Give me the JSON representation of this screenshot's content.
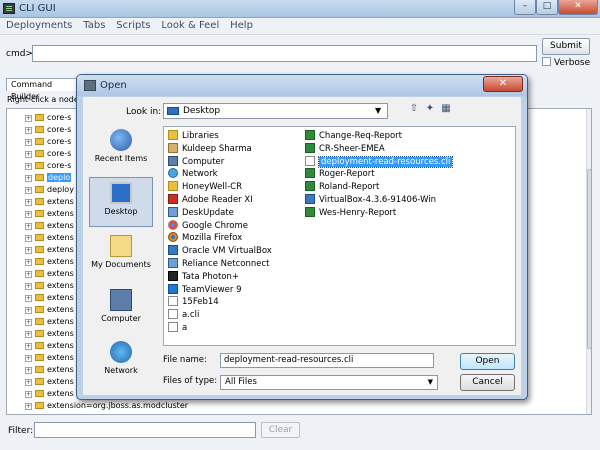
{
  "window": {
    "title": "CLI GUI",
    "controls": {
      "minimize": "–",
      "maximize": "□",
      "close": "✕"
    }
  },
  "menubar": [
    "Deployments",
    "Tabs",
    "Scripts",
    "Look & Feel",
    "Help"
  ],
  "command": {
    "label": "cmd>",
    "value": "",
    "submit_label": "Submit",
    "verbose_label": "Verbose",
    "verbose_checked": false
  },
  "tab_label": "Command Builder",
  "hint": "Right-click a node",
  "tree": {
    "items": [
      {
        "label": "core-s",
        "expander": "+"
      },
      {
        "label": "core-s",
        "expander": "+"
      },
      {
        "label": "core-s",
        "expander": "+"
      },
      {
        "label": "core-s",
        "expander": "+"
      },
      {
        "label": "core-s",
        "expander": "+"
      },
      {
        "label": "deplo",
        "expander": "+",
        "selected": true
      },
      {
        "label": "deploy",
        "expander": "+"
      },
      {
        "label": "extens",
        "expander": "+"
      },
      {
        "label": "extens",
        "expander": "+"
      },
      {
        "label": "extens",
        "expander": "+"
      },
      {
        "label": "extens",
        "expander": "+"
      },
      {
        "label": "extens",
        "expander": "+"
      },
      {
        "label": "extens",
        "expander": "+"
      },
      {
        "label": "extens",
        "expander": "+"
      },
      {
        "label": "extens",
        "expander": "+"
      },
      {
        "label": "extens",
        "expander": "+"
      },
      {
        "label": "extens",
        "expander": "+"
      },
      {
        "label": "extens",
        "expander": "+"
      },
      {
        "label": "extens",
        "expander": "+"
      },
      {
        "label": "extens",
        "expander": "+"
      },
      {
        "label": "extens",
        "expander": "+"
      },
      {
        "label": "extens",
        "expander": "+"
      },
      {
        "label": "extens",
        "expander": "+"
      },
      {
        "label": "extens",
        "expander": "+"
      },
      {
        "label": "extension=org.jboss.as.modcluster",
        "expander": "+"
      }
    ]
  },
  "filter": {
    "label": "Filter:",
    "value": "",
    "clear_label": "Clear"
  },
  "dialog": {
    "title": "Open",
    "close": "✕",
    "look_in_label": "Look in:",
    "look_in_value": "Desktop",
    "toolbar_icons": [
      "up-folder-icon",
      "new-folder-icon",
      "view-menu-icon"
    ],
    "places": [
      {
        "label": "Recent Items",
        "icon": "recent-items-icon"
      },
      {
        "label": "Desktop",
        "icon": "desktop-icon",
        "selected": true
      },
      {
        "label": "My Documents",
        "icon": "documents-icon"
      },
      {
        "label": "Computer",
        "icon": "computer-icon"
      },
      {
        "label": "Network",
        "icon": "network-icon"
      }
    ],
    "files_col1": [
      {
        "name": "Libraries",
        "icon": "folder"
      },
      {
        "name": "Kuldeep Sharma",
        "icon": "user"
      },
      {
        "name": "Computer",
        "icon": "computer"
      },
      {
        "name": "Network",
        "icon": "network"
      },
      {
        "name": "HoneyWell-CR",
        "icon": "folder"
      },
      {
        "name": "Adobe Reader XI",
        "icon": "pdf"
      },
      {
        "name": "DeskUpdate",
        "icon": "app"
      },
      {
        "name": "Google Chrome",
        "icon": "chrome"
      },
      {
        "name": "Mozilla Firefox",
        "icon": "firefox"
      },
      {
        "name": "Oracle VM VirtualBox",
        "icon": "vbox"
      },
      {
        "name": "Reliance Netconnect",
        "icon": "app"
      },
      {
        "name": "Tata Photon+",
        "icon": "tata"
      },
      {
        "name": "TeamViewer 9",
        "icon": "tv"
      },
      {
        "name": "15Feb14",
        "icon": "doc"
      },
      {
        "name": "a.cli",
        "icon": "doc"
      },
      {
        "name": "a",
        "icon": "doc"
      }
    ],
    "files_col2": [
      {
        "name": "Change-Req-Report",
        "icon": "xls"
      },
      {
        "name": "CR-Sheer-EMEA",
        "icon": "xls"
      },
      {
        "name": "deployment-read-resources.cli",
        "icon": "doc",
        "selected": true
      },
      {
        "name": "Roger-Report",
        "icon": "xls"
      },
      {
        "name": "Roland-Report",
        "icon": "xls"
      },
      {
        "name": "VirtualBox-4.3.6-91406-Win",
        "icon": "vbox"
      },
      {
        "name": "Wes-Henry-Report",
        "icon": "xls"
      }
    ],
    "file_name_label": "File name:",
    "file_name_value": "deployment-read-resources.cli",
    "files_of_type_label": "Files of type:",
    "files_of_type_value": "All Files",
    "open_label": "Open",
    "cancel_label": "Cancel"
  }
}
